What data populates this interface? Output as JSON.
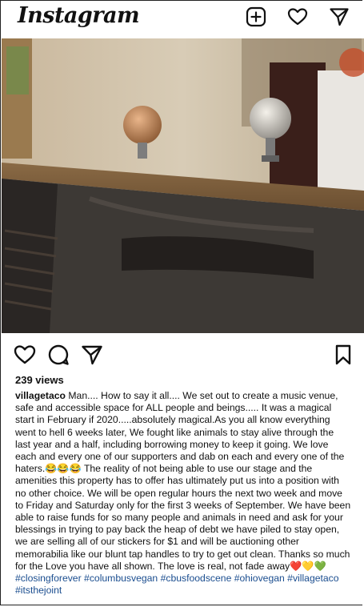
{
  "app": {
    "logo_text": "Instagram"
  },
  "topbar": {
    "icons": [
      "new-post-icon",
      "heart-icon",
      "direct-message-icon"
    ]
  },
  "post": {
    "media_alt": "video frame of a bar counter with disco balls",
    "action_icons": [
      "heart-icon",
      "comment-icon",
      "share-icon",
      "bookmark-icon"
    ],
    "views": "239 views",
    "username": "villagetaco",
    "caption_text": "Man.... How to say it all.... We set out to create a music venue, safe and accessible space for ALL people and beings..... It was a magical start in February if 2020.....absolutely magical.As you all know everything went to hell 6 weeks later, We fought like animals to stay alive through the last year and a half, including borrowing money to keep it going. We love each and every one of our supporters and dab on each and every one of the haters.😂😂😂 The reality of not being able to use our stage and the amenities this property has to offer has ultimately put us into a position with no other choice. We will be open regular hours the next two week and move to Friday and Saturday only for the first 3 weeks of September. We have  been able to raise funds for so many people and animals in need and ask for your blessings in trying to pay back the heap of debt we have piled to stay open, we are selling all of our stickers for $1 and will be auctioning other memorabilia like our blunt tap handles to try to get out clean. Thanks so much for the Love you have all shown. The love is real, not fade away❤️💛💚",
    "hashtags": [
      "#closingforever",
      "#columbusvegan",
      "#cbusfoodscene",
      "#ohiovegan",
      "#villagetaco",
      "#itsthejoint"
    ]
  },
  "colors": {
    "hashtag": "#1a4d8f",
    "text": "#111111",
    "background": "#ffffff"
  }
}
